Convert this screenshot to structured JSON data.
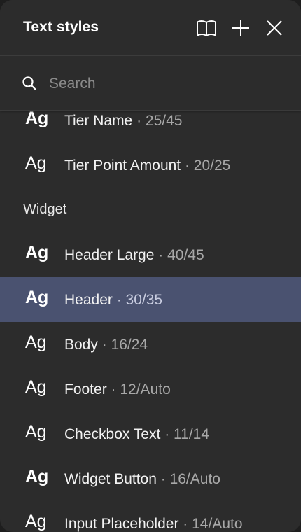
{
  "header": {
    "title": "Text styles"
  },
  "search": {
    "placeholder": "Search"
  },
  "list": {
    "top_items": [
      {
        "name": "Tier Name",
        "meta": " · 25/45"
      },
      {
        "name": "Tier Point Amount",
        "meta": " · 20/25"
      }
    ],
    "section_label": "Widget",
    "widget_items": [
      {
        "name": "Header Large",
        "meta": " · 40/45"
      },
      {
        "name": "Header",
        "meta": " · 30/35"
      },
      {
        "name": "Body",
        "meta": " · 16/24"
      },
      {
        "name": "Footer",
        "meta": " · 12/Auto"
      },
      {
        "name": "Checkbox Text",
        "meta": " · 11/14"
      },
      {
        "name": "Widget Button",
        "meta": " · 16/Auto"
      },
      {
        "name": "Input Placeholder",
        "meta": " · 14/Auto"
      }
    ],
    "preview_glyph": "Ag"
  },
  "colors": {
    "panel_bg": "#2c2c2c",
    "selected_bg": "#4a5270",
    "text_primary": "#f2f2f2",
    "text_secondary": "#a8a8a8"
  },
  "icons": [
    "book-icon",
    "plus-icon",
    "close-icon",
    "search-icon"
  ]
}
